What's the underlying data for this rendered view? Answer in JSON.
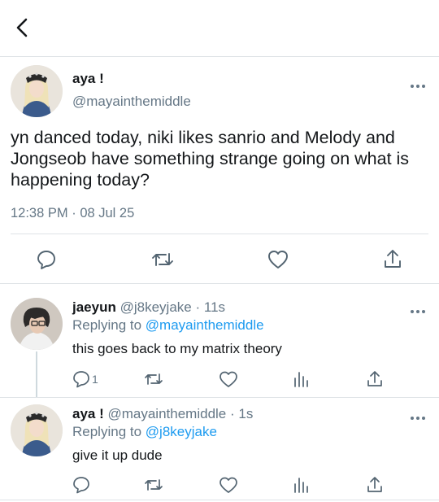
{
  "header": {
    "back_icon": "chevron-left-icon"
  },
  "main_tweet": {
    "display_name": "aya !",
    "handle": "@mayainthemiddle",
    "text": "yn danced today, niki likes sanrio and Melody and Jongseob have something strange going on what is happening today?",
    "time": "12:38 PM",
    "date": "08 Jul 25",
    "dot": "·",
    "actions": [
      "reply-icon",
      "retweet-icon",
      "like-icon",
      "share-icon"
    ]
  },
  "replies": [
    {
      "display_name": "jaeyun",
      "handle": "@j8keyjake",
      "age": "11s",
      "replying_prefix": "Replying to",
      "replying_to": "@mayainthemiddle",
      "text": "this goes back to my matrix theory",
      "reply_count": "1"
    },
    {
      "display_name": "aya !",
      "handle": "@mayainthemiddle",
      "age": "1s",
      "replying_prefix": "Replying to",
      "replying_to": "@j8keyjake",
      "text": "give it up dude",
      "reply_count": ""
    }
  ],
  "dot": "·",
  "colors": {
    "link": "#1d9bf0",
    "muted": "#657786",
    "text": "#14171a",
    "divider": "#dfe3e7"
  }
}
